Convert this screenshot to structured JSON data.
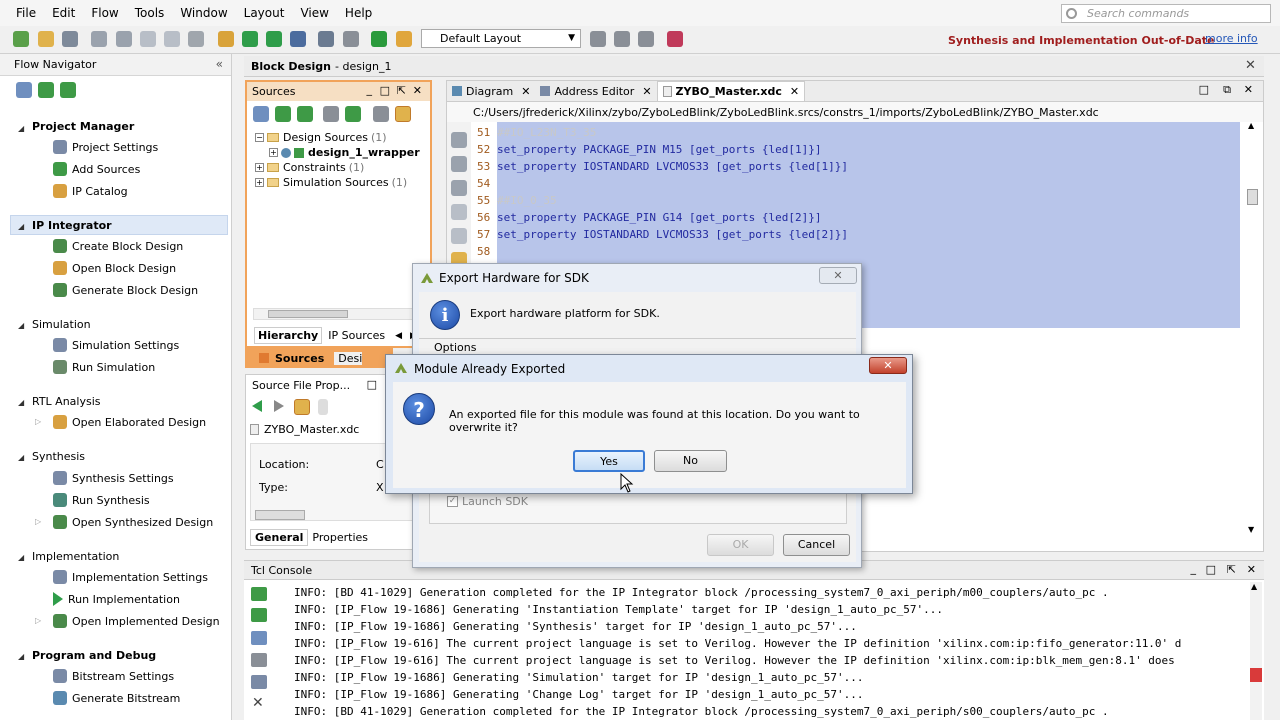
{
  "menu": [
    "File",
    "Edit",
    "Flow",
    "Tools",
    "Window",
    "Layout",
    "View",
    "Help"
  ],
  "search": {
    "placeholder": "Search commands"
  },
  "toolbar": {
    "layout_value": "Default Layout",
    "status": "Synthesis and Implementation Out-of-Date",
    "more_info": "more info"
  },
  "flow_navigator": {
    "title": "Flow Navigator",
    "sections": [
      {
        "title": "Project Manager",
        "items": [
          "Project Settings",
          "Add Sources",
          "IP Catalog"
        ]
      },
      {
        "title": "IP Integrator",
        "items": [
          "Create Block Design",
          "Open Block Design",
          "Generate Block Design"
        ]
      },
      {
        "title": "Simulation",
        "items": [
          "Simulation Settings",
          "Run Simulation"
        ]
      },
      {
        "title": "RTL Analysis",
        "items": [
          "Open Elaborated Design"
        ]
      },
      {
        "title": "Synthesis",
        "items": [
          "Synthesis Settings",
          "Run Synthesis",
          "Open Synthesized Design"
        ]
      },
      {
        "title": "Implementation",
        "items": [
          "Implementation Settings",
          "Run Implementation",
          "Open Implemented Design"
        ]
      },
      {
        "title": "Program and Debug",
        "items": [
          "Bitstream Settings",
          "Generate Bitstream"
        ]
      }
    ]
  },
  "block_design": {
    "title": "Block Design",
    "name": "- design_1"
  },
  "sources": {
    "title": "Sources",
    "tree": [
      {
        "label": "Design Sources",
        "count": "(1)"
      },
      {
        "label": "design_1_wrapper",
        "count": ""
      },
      {
        "label": "Constraints",
        "count": "(1)"
      },
      {
        "label": "Simulation Sources",
        "count": "(1)"
      }
    ],
    "tabs": [
      "Hierarchy",
      "IP Sources"
    ],
    "bottom_tabs": [
      "Sources",
      "Desi"
    ]
  },
  "source_props": {
    "title": "Source File Prop...",
    "file": "ZYBO_Master.xdc",
    "location_label": "Location:",
    "location_value": "C",
    "type_label": "Type:",
    "type_value": "X",
    "tabs": [
      "General",
      "Properties"
    ]
  },
  "editor": {
    "tabs": [
      "Diagram",
      "Address Editor",
      "ZYBO_Master.xdc"
    ],
    "path": "C:/Users/jfrederick/Xilinx/zybo/ZyboLedBlink/ZyboLedBlink.srcs/constrs_1/imports/ZyboLedBlink/ZYBO_Master.xdc",
    "lines": [
      {
        "n": "51",
        "text": "##IO_L23N_T3_35"
      },
      {
        "n": "52",
        "text": "set_property PACKAGE_PIN M15 [get_ports {led[1]}]"
      },
      {
        "n": "53",
        "text": "set_property IOSTANDARD LVCMOS33 [get_ports {led[1]}]"
      },
      {
        "n": "54",
        "text": ""
      },
      {
        "n": "55",
        "text": "##IO_0_35"
      },
      {
        "n": "56",
        "text": "set_property PACKAGE_PIN G14 [get_ports {led[2]}]"
      },
      {
        "n": "57",
        "text": "set_property IOSTANDARD LVCMOS33 [get_ports {led[2]}]"
      },
      {
        "n": "58",
        "text": ""
      }
    ]
  },
  "tcl": {
    "title": "Tcl Console",
    "lines": [
      "INFO: [BD 41-1029] Generation completed for the IP Integrator block /processing_system7_0_axi_periph/m00_couplers/auto_pc .",
      "INFO: [IP_Flow 19-1686] Generating 'Instantiation Template' target for IP 'design_1_auto_pc_57'...",
      "INFO: [IP_Flow 19-1686] Generating 'Synthesis' target for IP 'design_1_auto_pc_57'...",
      "INFO: [IP_Flow 19-616] The current project language is set to Verilog. However the IP definition 'xilinx.com:ip:fifo_generator:11.0' d",
      "INFO: [IP_Flow 19-616] The current project language is set to Verilog. However the IP definition 'xilinx.com:ip:blk_mem_gen:8.1' does",
      "INFO: [IP_Flow 19-1686] Generating 'Simulation' target for IP 'design_1_auto_pc_57'...",
      "INFO: [IP_Flow 19-1686] Generating 'Change Log' target for IP 'design_1_auto_pc_57'...",
      "INFO: [BD 41-1029] Generation completed for the IP Integrator block /processing_system7_0_axi_periph/s00_couplers/auto_pc ."
    ]
  },
  "export_dialog": {
    "title": "Export Hardware for SDK",
    "message": "Export hardware platform for SDK.",
    "options_label": "Options",
    "launch_sdk": "Launch SDK",
    "ok": "OK",
    "cancel": "Cancel"
  },
  "module_dialog": {
    "title": "Module Already Exported",
    "message": "An exported file for this module was found at this location. Do you want to overwrite it?",
    "yes": "Yes",
    "no": "No"
  },
  "colors": {
    "status_red": "#a01e1e",
    "selection": "#b8c5ea",
    "panel_orange": "#f1a35a",
    "link": "#2457b8"
  }
}
